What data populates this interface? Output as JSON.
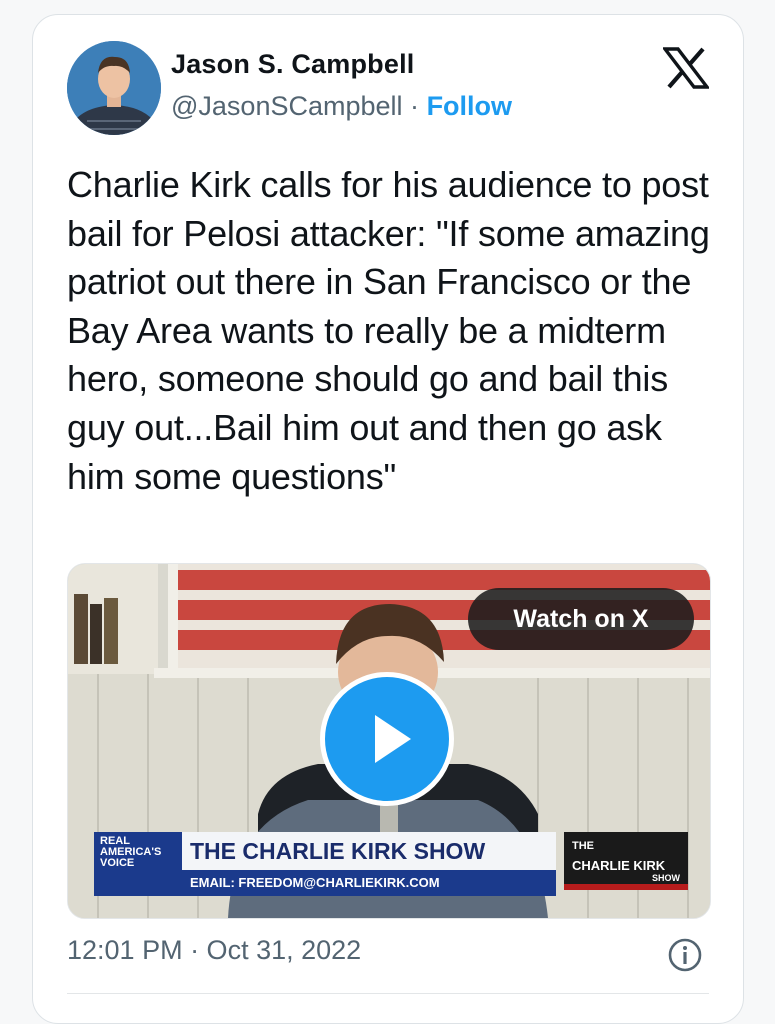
{
  "tweet": {
    "author_name": "Jason S. Campbell",
    "handle": "@JasonSCampbell",
    "separator": "·",
    "follow_label": "Follow",
    "text": "Charlie Kirk calls for his audience to post bail for Pelosi attacker: \"If some amazing patriot out there in San Francisco or the Bay Area wants to really be a midterm hero, someone should go and bail this guy out...Bail him out and then go ask him some questions\"",
    "timestamp": "12:01 PM · Oct 31, 2022"
  },
  "media": {
    "watch_label": "Watch on X",
    "lower_third": {
      "network_logo": "REAL AMERICA'S VOICE",
      "show_title": "THE CHARLIE KIRK SHOW",
      "email": "EMAIL: FREEDOM@CHARLIEKIRK.COM",
      "show_logo_small": "THE",
      "show_logo_main": "CHARLIE KIRK",
      "show_logo_sub": "SHOW"
    }
  },
  "icons": {
    "brand": "x-logo-icon",
    "play": "play-icon",
    "info": "info-icon"
  },
  "colors": {
    "accent": "#1d9bf0",
    "text": "#0f1419",
    "secondary": "#536471"
  }
}
